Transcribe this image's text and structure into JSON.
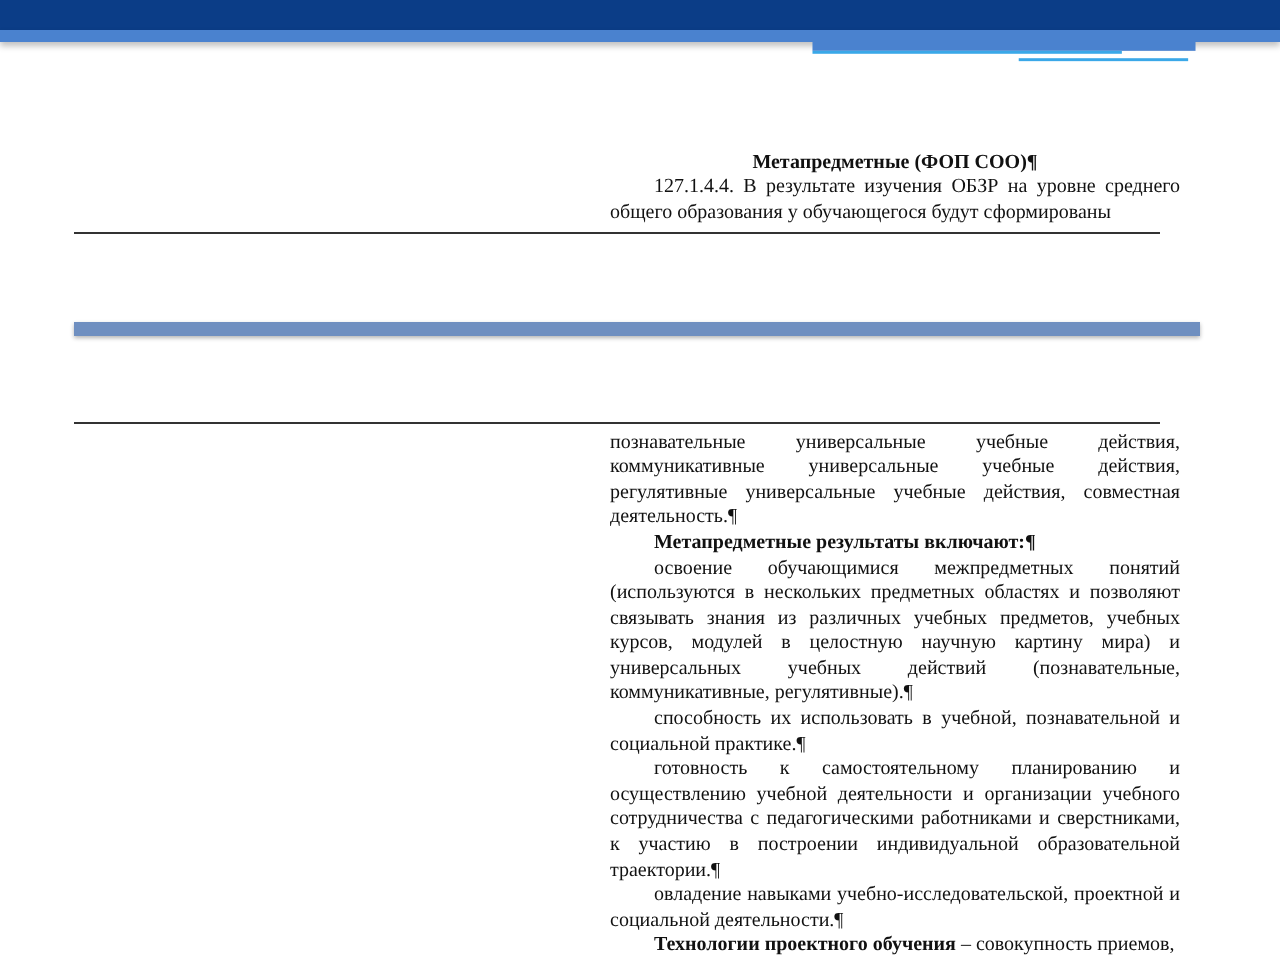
{
  "top_fragment": {
    "heading": "Метапредметные (ФОП СОО)¶",
    "paragraph": "127.1.4.4. В результате изучения ОБЗР на уровне среднего общего образования у обучающегося будут сформированы"
  },
  "bottom_fragment": [
    {
      "kind": "continuation",
      "text": "познавательные универсальные учебные действия, коммуникативные универсальные учебные действия, регулятивные универсальные учебные действия, совместная деятельность.¶"
    },
    {
      "kind": "heading",
      "text": "Метапредметные результаты включают:¶"
    },
    {
      "kind": "item",
      "text": "освоение обучающимися межпредметных понятий (используются в нескольких предметных областях и позволяют связывать знания из различных учебных предметов, учебных курсов, модулей в целостную научную картину мира) и универсальных учебных действий (познавательные, коммуникативные, регулятивные).¶"
    },
    {
      "kind": "item",
      "text": "способность их использовать в учебной, познавательной и социальной практике.¶"
    },
    {
      "kind": "item",
      "text": "готовность к самостоятельному планированию и осуществлению учебной деятельности и организации учебного сотрудничества с педагогическими работниками и сверстниками, к участию в построении индивидуальной образовательной траектории.¶"
    },
    {
      "kind": "item",
      "text": "овладение навыками учебно-исследовательской, проектной и социальной деятельности.¶"
    },
    {
      "kind": "item",
      "text": "**Технологии проектного обучения** – совокупность приемов,"
    }
  ]
}
